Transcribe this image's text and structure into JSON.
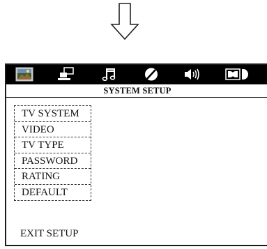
{
  "menu_bar": {
    "tabs": [
      {
        "icon": "general-setup-picture-icon",
        "selected": true
      },
      {
        "icon": "video-setup-icon"
      },
      {
        "icon": "audio-music-note-icon"
      },
      {
        "icon": "preference-disc-icon"
      },
      {
        "icon": "speaker-volume-icon"
      },
      {
        "icon": "dolby-digital-icon"
      }
    ]
  },
  "title": "SYSTEM SETUP",
  "menu": {
    "items": [
      "TV SYSTEM",
      "VIDEO",
      "TV TYPE",
      "PASSWORD",
      "RATING",
      "DEFAULT"
    ]
  },
  "exit_label": "EXIT SETUP",
  "colors": {
    "icon_bar": "#000000",
    "icon": "#ffffff",
    "text": "#111111"
  }
}
